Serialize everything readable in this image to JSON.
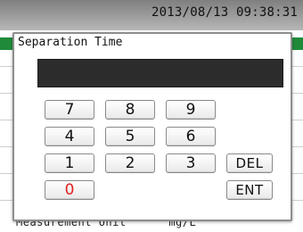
{
  "status_bar": {
    "datetime": "2013/08/13 09:38:31"
  },
  "background": {
    "label": "Measurement Unit",
    "unit": "mg/L"
  },
  "dialog": {
    "title": "Separation Time",
    "display_value": "",
    "keys": {
      "k7": "7",
      "k8": "8",
      "k9": "9",
      "k4": "4",
      "k5": "5",
      "k6": "6",
      "k1": "1",
      "k2": "2",
      "k3": "3",
      "del": "DEL",
      "k0": "0",
      "ent": "ENT"
    }
  },
  "colors": {
    "accent_strip": "#1f8b3a",
    "zero_key_text": "#e02020",
    "display_background": "#2c2c2c"
  }
}
